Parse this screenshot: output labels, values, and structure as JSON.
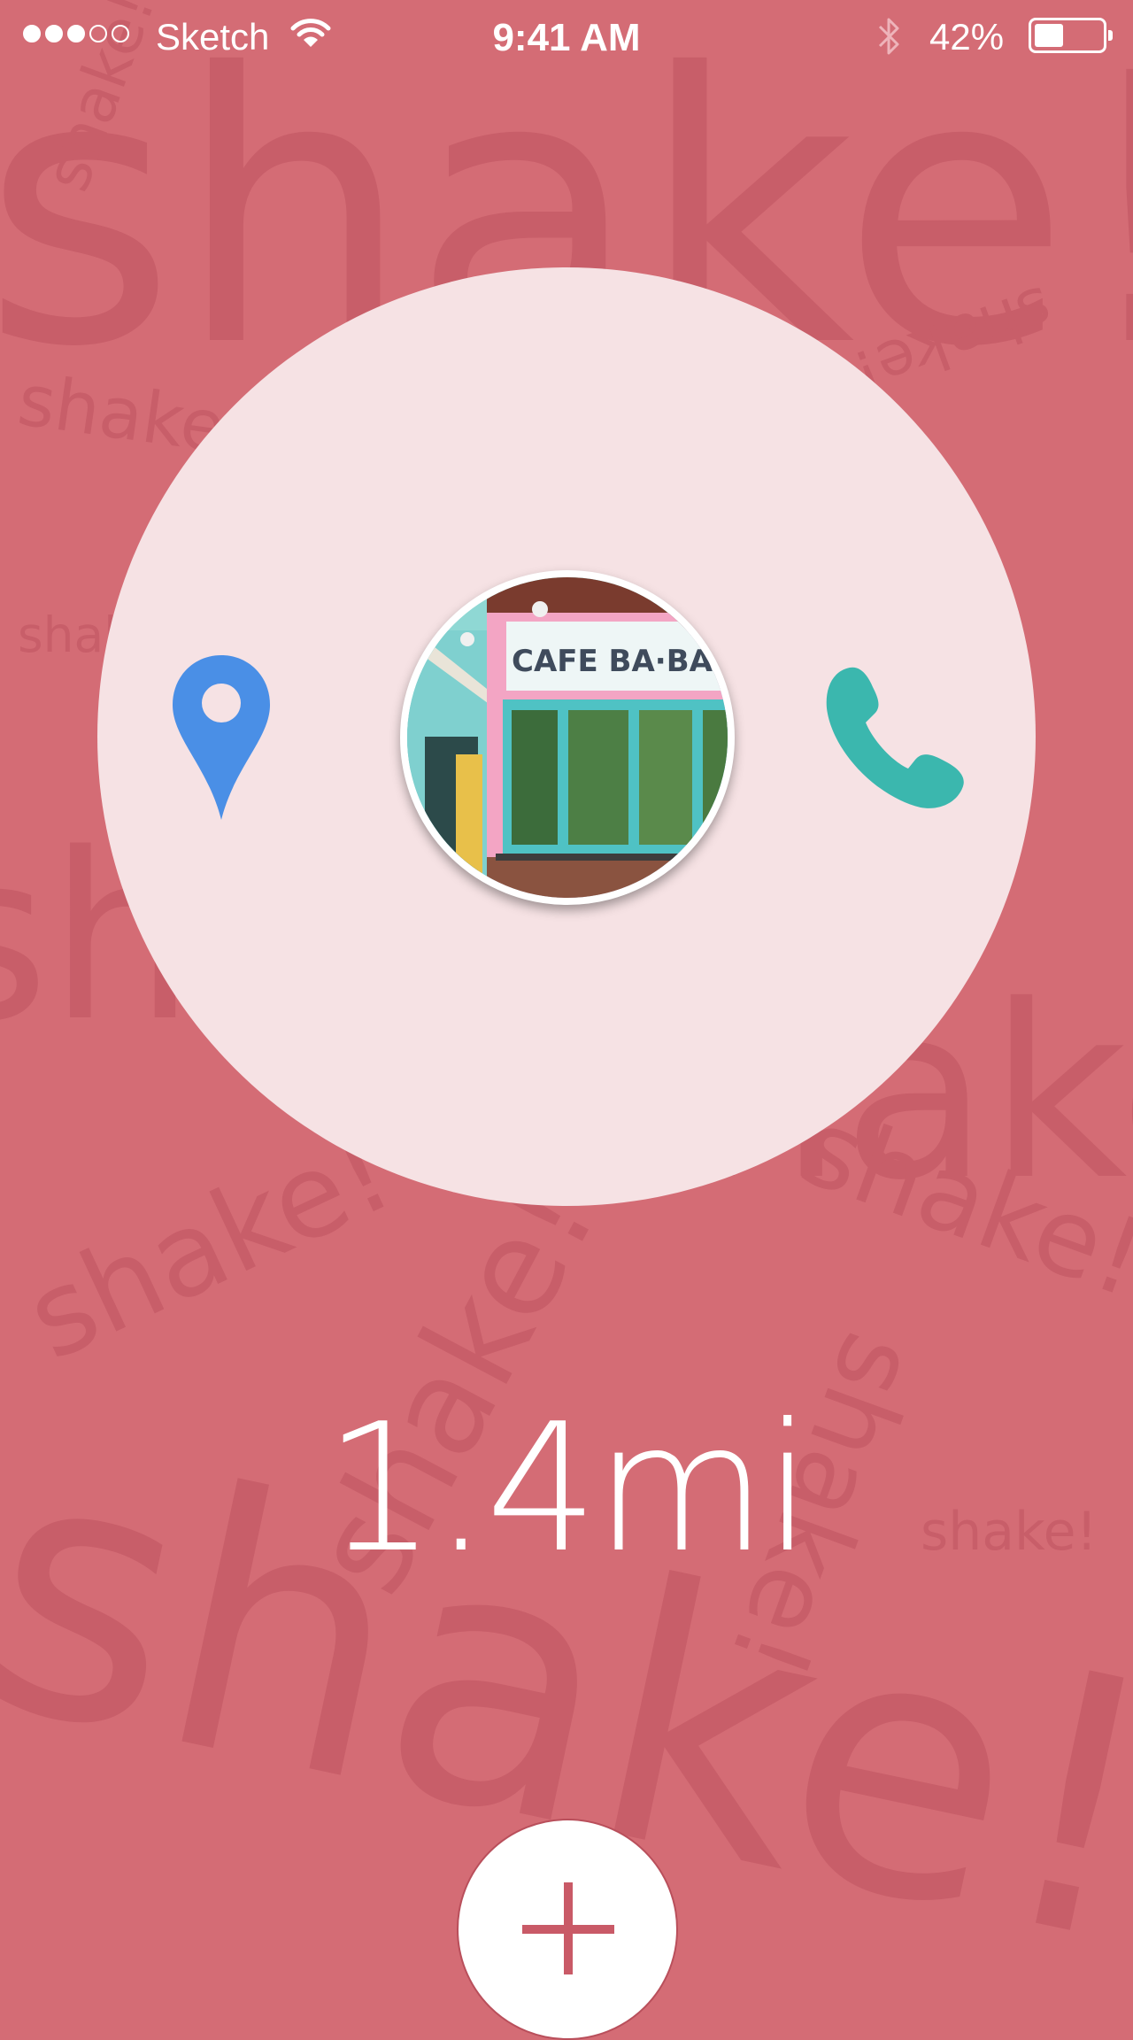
{
  "status_bar": {
    "carrier": "Sketch",
    "time": "9:41 AM",
    "battery_percent": "42%",
    "battery_level": 0.42,
    "signal_dots_filled": 3,
    "signal_dots_total": 5
  },
  "watermark": {
    "text": "shake!"
  },
  "place": {
    "photo_sign_text": "CAFE BA·BA·REE",
    "distance": "1.4mi"
  },
  "actions": {
    "directions_icon": "location-pin-icon",
    "call_icon": "phone-icon",
    "add_icon": "plus-icon"
  },
  "colors": {
    "background": "#d46c75",
    "card": "#f6e2e4",
    "pin": "#4a8fe6",
    "phone": "#3bb7ae",
    "plus": "#c95a67"
  }
}
